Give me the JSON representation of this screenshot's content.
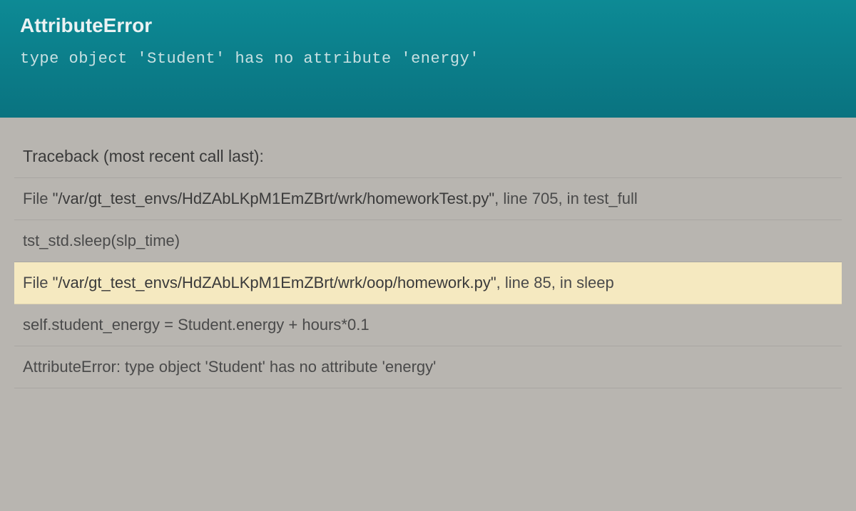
{
  "error": {
    "type": "AttributeError",
    "message": "type object 'Student' has no attribute 'energy'"
  },
  "traceback": {
    "header": "Traceback (most recent call last):",
    "frames": [
      {
        "prefix": "File ",
        "path": "\"/var/gt_test_envs/HdZAbLKpM1EmZBrt/wrk/homeworkTest.py\"",
        "suffix": ", line 705, in test_full",
        "code": "tst_std.sleep(slp_time)",
        "highlighted": false
      },
      {
        "prefix": "File ",
        "path": "\"/var/gt_test_envs/HdZAbLKpM1EmZBrt/wrk/oop/homework.py\"",
        "suffix": ", line 85, in sleep",
        "code": "self.student_energy = Student.energy + hours*0.1",
        "highlighted": true
      }
    ],
    "final": "AttributeError: type object 'Student' has no attribute 'energy'"
  }
}
